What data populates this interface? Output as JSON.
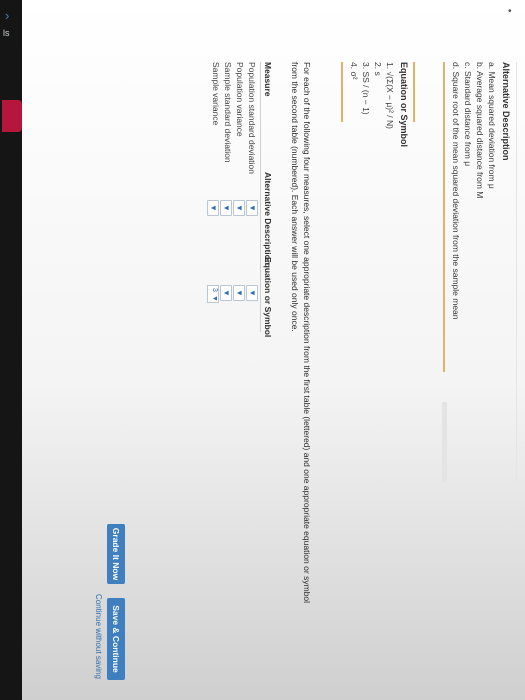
{
  "side": {
    "dots_label": "ls"
  },
  "desc_table": {
    "header": "Alternative Description",
    "items": [
      "a. Mean squared deviation from μ",
      "b. Average squared distance from M",
      "c. Standard distance from μ",
      "d. Square root of the mean squared deviation from the sample mean"
    ]
  },
  "eq_table": {
    "header": "Equation or Symbol",
    "items": [
      "1. √(Σ(X − μ)² / N)",
      "2. s",
      "3. SS / (n − 1)",
      "4. σ²"
    ]
  },
  "instructions": "For each of the following four measures, select one appropriate description from the first table (lettered) and one appropriate equation or symbol from the second table (numbered). Each answer will be used only once.",
  "answer_table": {
    "col_measure": "Measure",
    "col_desc": "Alternative Description",
    "col_eq": "Equation or Symbol",
    "rows": [
      {
        "measure": "Population standard deviation",
        "eq_value": ""
      },
      {
        "measure": "Population variance",
        "eq_value": ""
      },
      {
        "measure": "Sample standard deviation",
        "eq_value": ""
      },
      {
        "measure": "Sample variance",
        "eq_value": "3"
      }
    ]
  },
  "buttons": {
    "grade": "Grade It Now",
    "save": "Save & Continue",
    "continue_link": "Continue without saving"
  },
  "colors": {
    "accent": "#3f7fbf",
    "gold": "#e0b36a",
    "sidebar": "#151515"
  }
}
